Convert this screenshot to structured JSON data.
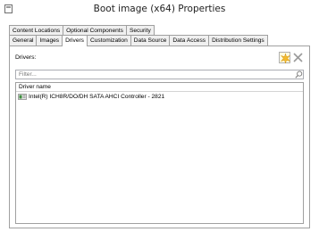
{
  "window": {
    "title": "Boot image (x64) Properties",
    "icon": "window-icon"
  },
  "tabs": {
    "back_row": [
      {
        "label": "Content Locations"
      },
      {
        "label": "Optional Components"
      },
      {
        "label": "Security"
      }
    ],
    "front_row": [
      {
        "label": "General"
      },
      {
        "label": "Images"
      },
      {
        "label": "Drivers",
        "active": true
      },
      {
        "label": "Customization"
      },
      {
        "label": "Data Source"
      },
      {
        "label": "Data Access"
      },
      {
        "label": "Distribution Settings"
      }
    ]
  },
  "drivers_panel": {
    "label": "Drivers:",
    "filter_placeholder": "Filter...",
    "toolbar": {
      "add_icon": "starburst-icon",
      "delete_icon": "delete-x-icon"
    },
    "list": {
      "column_header": "Driver name",
      "rows": [
        {
          "name": "Intel(R) ICH8R/DO/DH SATA AHCI Controller - 2821",
          "icon": "driver-icon"
        }
      ]
    }
  },
  "colors": {
    "border": "#a0a0a0",
    "tab_inactive_bg": "#f0f0f0",
    "star": "#f3b92c",
    "driver_icon_green": "#3f8f3f"
  }
}
